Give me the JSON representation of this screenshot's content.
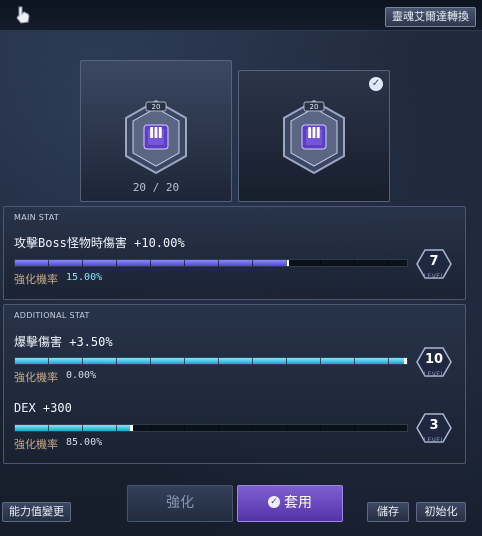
{
  "header": {
    "convert_label": "靈魂艾爾達轉換"
  },
  "slots": {
    "left": {
      "badge": "20",
      "glyph": "Ⅲ",
      "count": "20 / 20"
    },
    "right": {
      "badge": "20",
      "glyph": "Ⅲ"
    }
  },
  "main_stat": {
    "heading": "MAIN STAT",
    "name": "攻擊Boss怪物時傷害 +10.00%",
    "chance_label": "強化機率",
    "chance_value": "15.00%",
    "level": "7",
    "level_label": "LEVEL",
    "progress": 0.7
  },
  "additional_stat": {
    "heading": "ADDITIONAL STAT",
    "stats": [
      {
        "name": "爆擊傷害 +3.50%",
        "chance_label": "強化機率",
        "chance_value": "0.00%",
        "level": "10",
        "level_label": "LEVEL",
        "progress": 1.0
      },
      {
        "name": "DEX +300",
        "chance_label": "強化機率",
        "chance_value": "85.00%",
        "level": "3",
        "level_label": "LEVEL",
        "progress": 0.3
      }
    ]
  },
  "buttons": {
    "stat_change": "能力值變更",
    "enhance": "強化",
    "apply": "套用",
    "save": "儲存",
    "initialize": "初始化"
  },
  "colors": {
    "main_bar": "#6a6cf0",
    "additional_bar": "#3cc8ea",
    "chance_highlight_main": "#7fe7ff",
    "chance_highlight_add": "#d6dbe6",
    "apply_button": "#6a4bc0"
  },
  "icons": [
    "tooltip-pointer-icon",
    "soul-emblem-icon",
    "check-icon",
    "level-hexagon-icon"
  ]
}
